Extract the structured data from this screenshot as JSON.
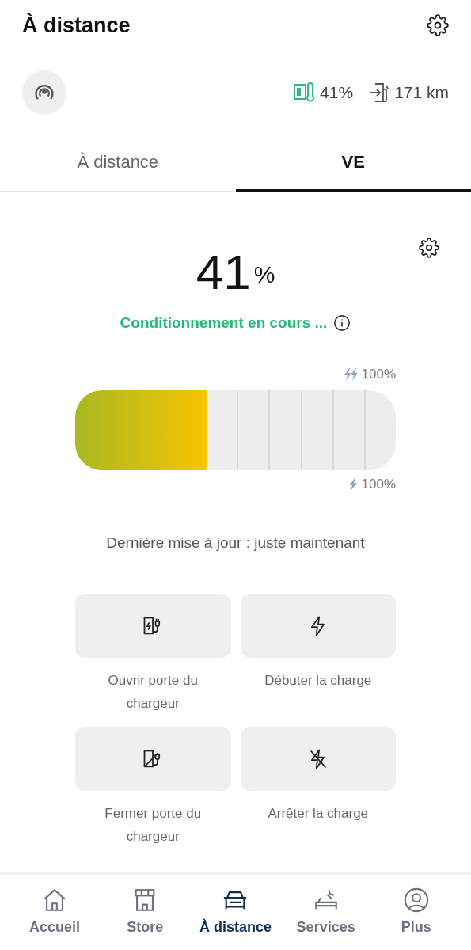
{
  "header": {
    "title": "À distance"
  },
  "status": {
    "battery": "41%",
    "range": "171 km"
  },
  "tabs": [
    {
      "label": "À distance",
      "selected": false
    },
    {
      "label": "VE",
      "selected": true
    }
  ],
  "charge": {
    "percent": "41",
    "unit": "%",
    "status": "Conditionnement en cours ...",
    "level": 0.41,
    "ac_limit": "100%",
    "dc_limit": "100%",
    "updated": "Dernière mise à jour : juste maintenant"
  },
  "actions": [
    {
      "kind": "open-port",
      "label": "Ouvrir porte du chargeur"
    },
    {
      "kind": "start",
      "label": "Débuter la charge"
    },
    {
      "kind": "close-port",
      "label": "Fermer porte du chargeur"
    },
    {
      "kind": "stop",
      "label": "Arrêter la charge"
    }
  ],
  "nav": [
    {
      "kind": "home",
      "label": "Accueil",
      "selected": false
    },
    {
      "kind": "store",
      "label": "Store",
      "selected": false
    },
    {
      "kind": "car",
      "label": "À distance",
      "selected": true
    },
    {
      "kind": "services",
      "label": "Services",
      "selected": false
    },
    {
      "kind": "profile",
      "label": "Plus",
      "selected": false
    }
  ]
}
